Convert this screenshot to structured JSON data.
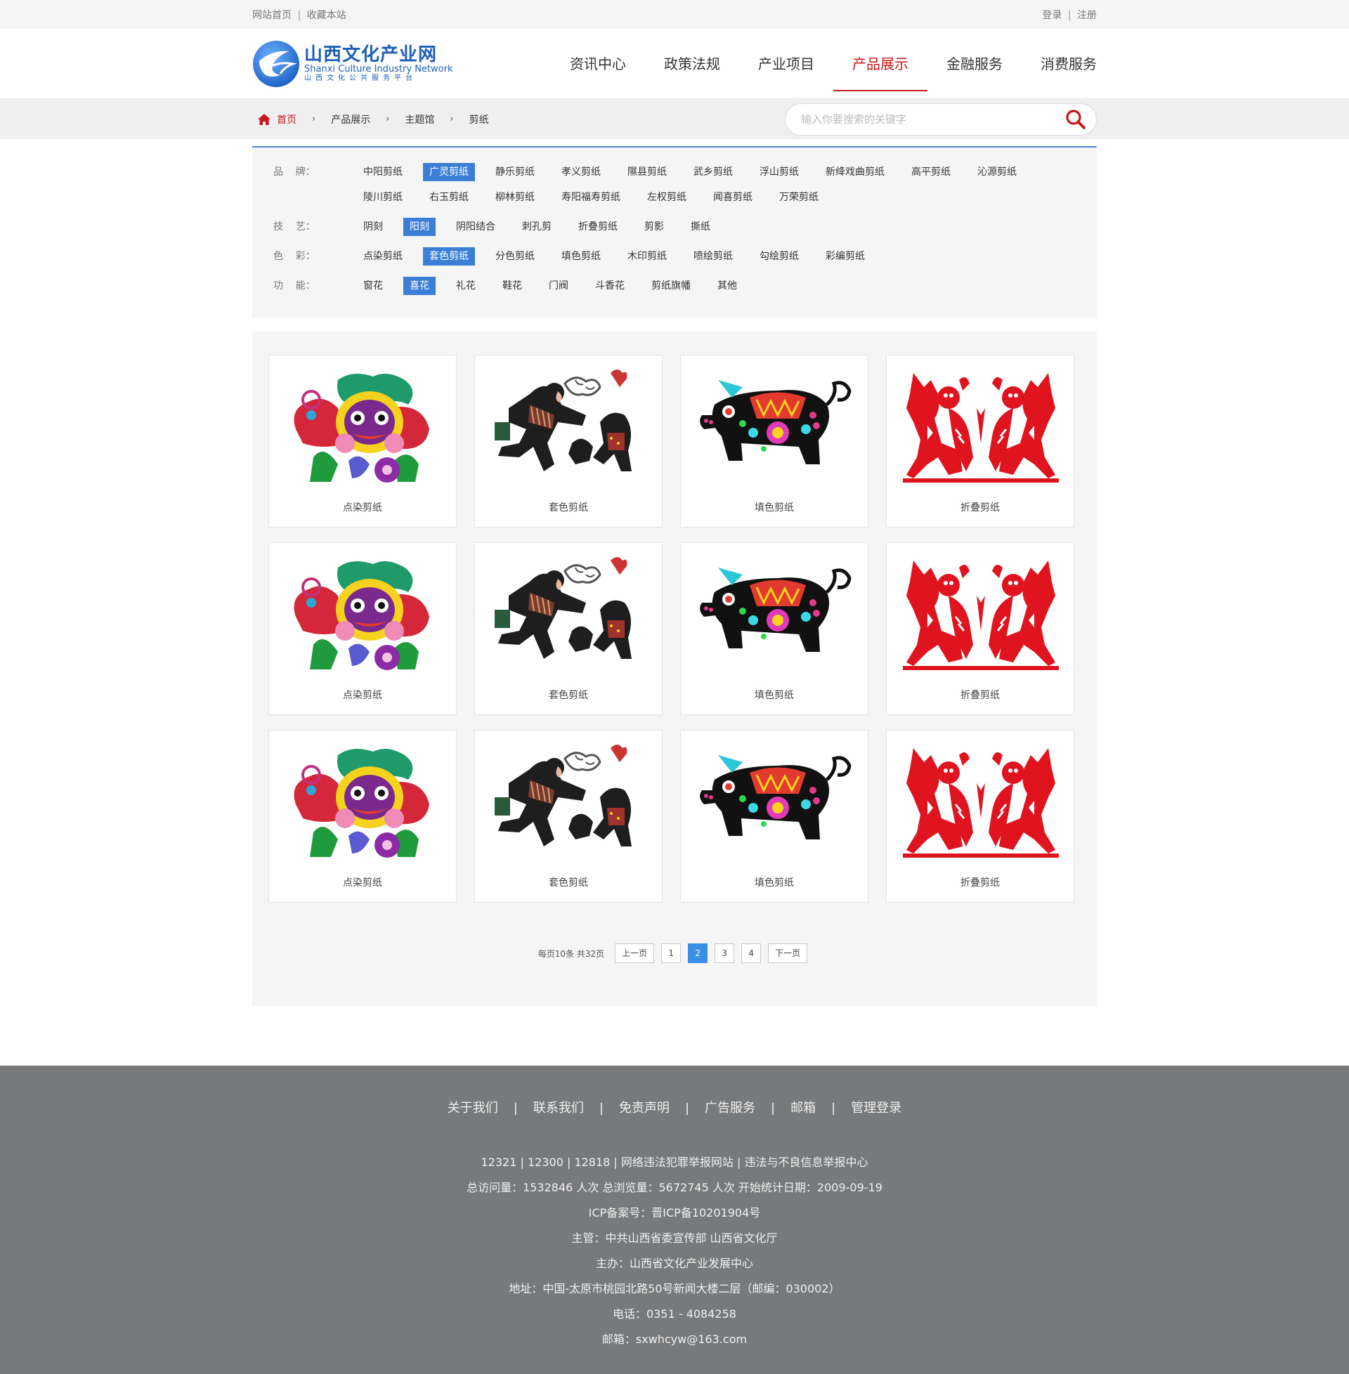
{
  "topbar": {
    "home_link": "网站首页",
    "fav_link": "收藏本站",
    "sep": "|",
    "login": "登录",
    "register": "注册"
  },
  "logo": {
    "cn": "山西文化产业网",
    "en": "Shanxi Culture Industry Network",
    "sub": "山西文化公共服务平台"
  },
  "nav": {
    "items": [
      "资讯中心",
      "政策法规",
      "产业项目",
      "产品展示",
      "金融服务",
      "消费服务"
    ],
    "active": "产品展示"
  },
  "breadcrumb": {
    "home": "首页",
    "arrow": "›",
    "items": [
      "产品展示",
      "主题馆",
      "剪纸"
    ]
  },
  "search": {
    "placeholder": "输入你要搜索的关键字"
  },
  "filters": {
    "brand": {
      "label": "品    牌：",
      "options": [
        "中阳剪纸",
        "广灵剪纸",
        "静乐剪纸",
        "孝义剪纸",
        "隰县剪纸",
        "武乡剪纸",
        "浮山剪纸",
        "新绛戏曲剪纸",
        "高平剪纸",
        "沁源剪纸",
        "陵川剪纸",
        "右玉剪纸",
        "柳林剪纸",
        "寿阳福寿剪纸",
        "左权剪纸",
        "闻喜剪纸",
        "万荣剪纸"
      ],
      "selected": "广灵剪纸"
    },
    "technique": {
      "label": "技    艺：",
      "options": [
        "阴刻",
        "阳刻",
        "阴阳结合",
        "刺孔剪",
        "折叠剪纸",
        "剪影",
        "撕纸"
      ],
      "selected": "阳刻"
    },
    "color": {
      "label": "色    彩：",
      "options": [
        "点染剪纸",
        "套色剪纸",
        "分色剪纸",
        "填色剪纸",
        "木印剪纸",
        "喷绘剪纸",
        "勾绘剪纸",
        "彩编剪纸"
      ],
      "selected": "套色剪纸"
    },
    "function": {
      "label": "功    能：",
      "options": [
        "窗花",
        "喜花",
        "礼花",
        "鞋花",
        "门阀",
        "斗香花",
        "剪纸旗幡",
        "其他"
      ],
      "selected": "喜花"
    }
  },
  "products": [
    {
      "title": "点染剪纸",
      "art": "lion"
    },
    {
      "title": "套色剪纸",
      "art": "kids"
    },
    {
      "title": "填色剪纸",
      "art": "pig"
    },
    {
      "title": "折叠剪纸",
      "art": "twins"
    },
    {
      "title": "点染剪纸",
      "art": "lion"
    },
    {
      "title": "套色剪纸",
      "art": "kids"
    },
    {
      "title": "填色剪纸",
      "art": "pig"
    },
    {
      "title": "折叠剪纸",
      "art": "twins"
    },
    {
      "title": "点染剪纸",
      "art": "lion"
    },
    {
      "title": "套色剪纸",
      "art": "kids"
    },
    {
      "title": "填色剪纸",
      "art": "pig"
    },
    {
      "title": "折叠剪纸",
      "art": "twins"
    }
  ],
  "pager": {
    "info": "每页10条 共32页",
    "prev": "上一页",
    "pages": [
      "1",
      "2",
      "3",
      "4"
    ],
    "current": "2",
    "next": "下一页"
  },
  "footer": {
    "links": [
      "关于我们",
      "联系我们",
      "免责声明",
      "广告服务",
      "邮箱",
      "管理登录"
    ],
    "sep": "|",
    "lines": [
      "12321 | 12300 | 12818 | 网络违法犯罪举报网站 | 违法与不良信息举报中心",
      "总访问量：1532846 人次  总浏览量：5672745 人次  开始统计日期：2009-09-19",
      "ICP备案号：晋ICP备10201904号",
      "主管：中共山西省委宣传部 山西省文化厅",
      "主办：山西省文化产业发展中心",
      "地址：中国-太原市桃园北路50号新闻大楼二层（邮编：030002）",
      "电话：0351 - 4084258",
      "邮箱：sxwhcyw@163.com"
    ]
  },
  "colors": {
    "accent_red": "#c8161d",
    "accent_blue": "#3a7fd5",
    "footer_bg": "#77797b"
  }
}
